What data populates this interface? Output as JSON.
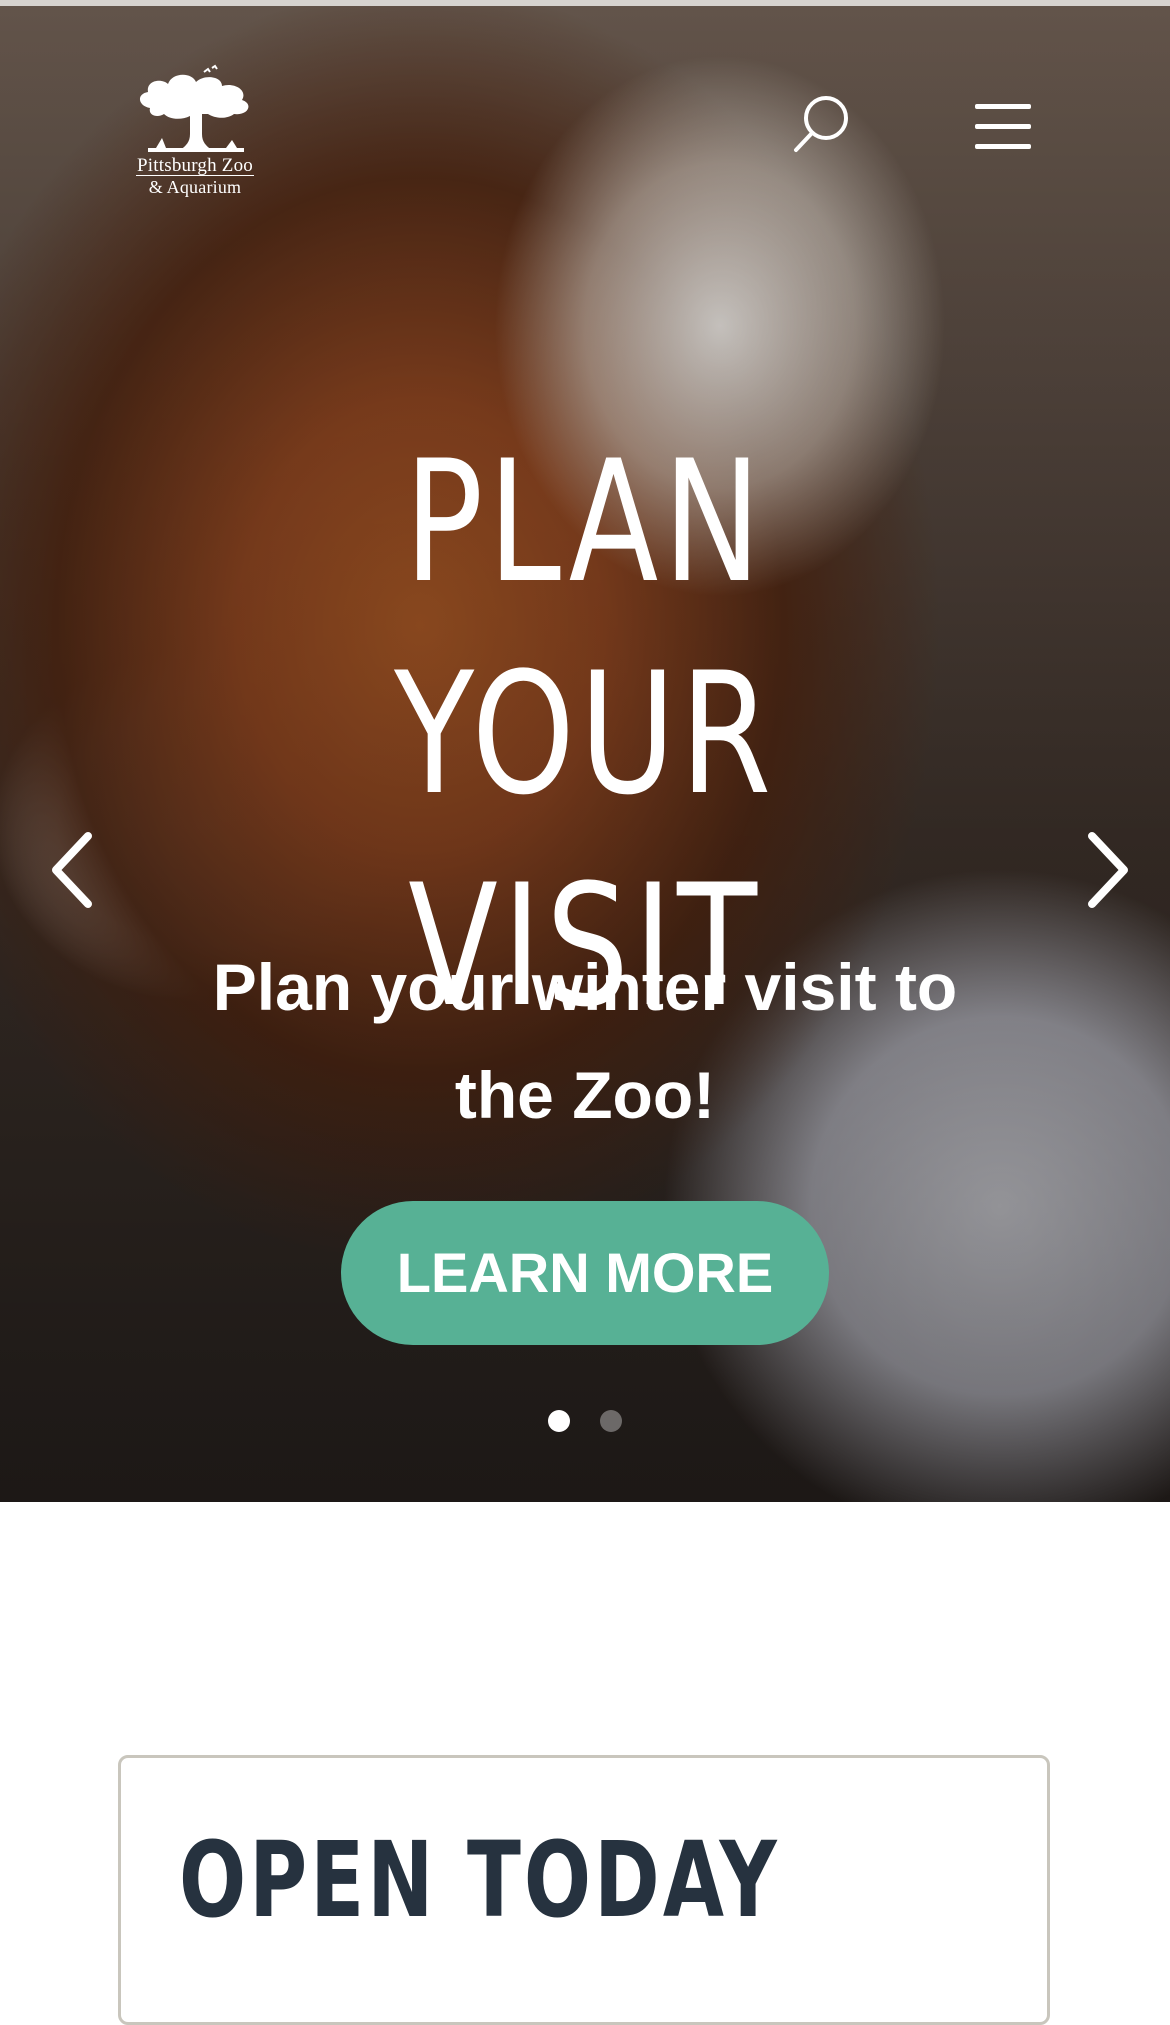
{
  "header": {
    "logo": {
      "line1": "Pittsburgh Zoo",
      "line2": "& Aquarium",
      "icon": "tree-logo-icon"
    },
    "search_icon": "search-icon",
    "menu_icon": "hamburger-menu-icon"
  },
  "hero": {
    "title": "PLAN YOUR VISIT",
    "subtitle": "Plan your winter visit to the Zoo!",
    "cta_label": "LEARN MORE",
    "prev_icon": "chevron-left-icon",
    "next_icon": "chevron-right-icon",
    "slides_total": 2,
    "active_slide": 1,
    "colors": {
      "cta_background": "#57b195",
      "text": "#ffffff"
    }
  },
  "hours_card": {
    "title": "OPEN TODAY",
    "colors": {
      "title": "#26323f",
      "border": "#c9c6bd"
    }
  }
}
